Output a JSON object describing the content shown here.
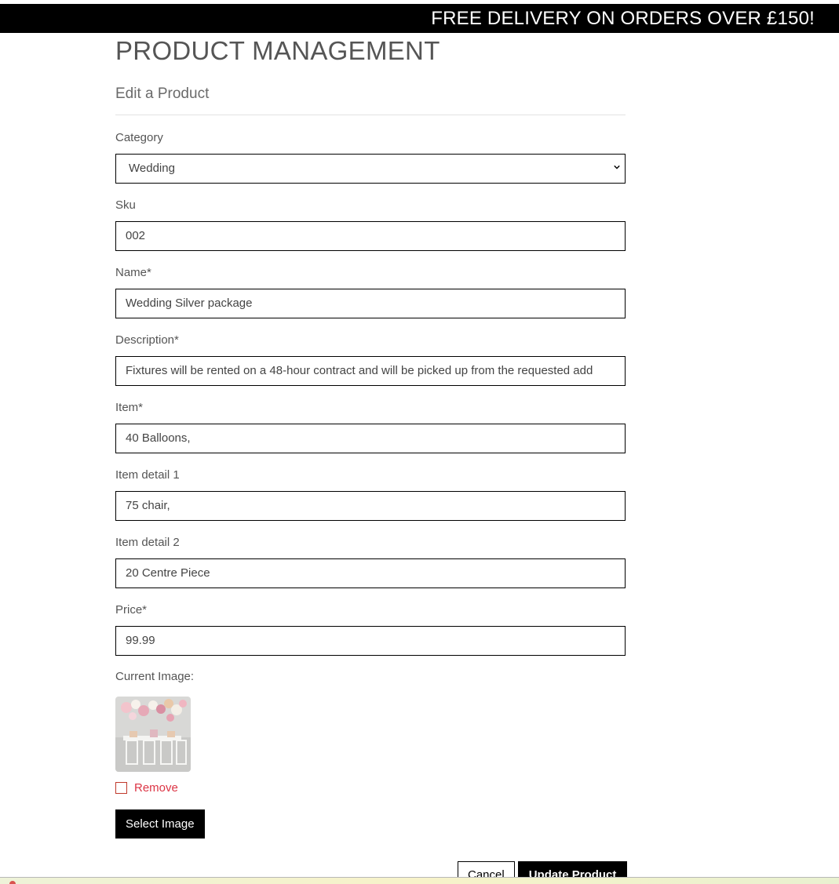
{
  "banner": {
    "text": "FREE DELIVERY ON ORDERS OVER £150!"
  },
  "page": {
    "title": "PRODUCT MANAGEMENT",
    "subtitle": "Edit a Product"
  },
  "form": {
    "category": {
      "label": "Category",
      "value": "Wedding"
    },
    "sku": {
      "label": "Sku",
      "value": "002"
    },
    "name": {
      "label": "Name*",
      "value": "Wedding Silver package"
    },
    "description": {
      "label": "Description*",
      "value": "Fixtures will be rented on a 48-hour contract and will be picked up from the requested add"
    },
    "item": {
      "label": "Item*",
      "value": "40 Balloons,"
    },
    "item_detail_1": {
      "label": "Item detail 1",
      "value": "75 chair,"
    },
    "item_detail_2": {
      "label": "Item detail 2",
      "value": "20 Centre Piece"
    },
    "price": {
      "label": "Price*",
      "value": "99.99"
    },
    "current_image": {
      "label": "Current Image:"
    },
    "remove": {
      "label": "Remove",
      "checked": false
    },
    "select_image_label": "Select Image",
    "cancel_label": "Cancel",
    "update_label": "Update Product"
  },
  "colors": {
    "banner_bg": "#000000",
    "remove_red": "#dc3545",
    "button_bg": "#000000"
  },
  "icons": {
    "select_chevron": "chevron-down-icon"
  }
}
